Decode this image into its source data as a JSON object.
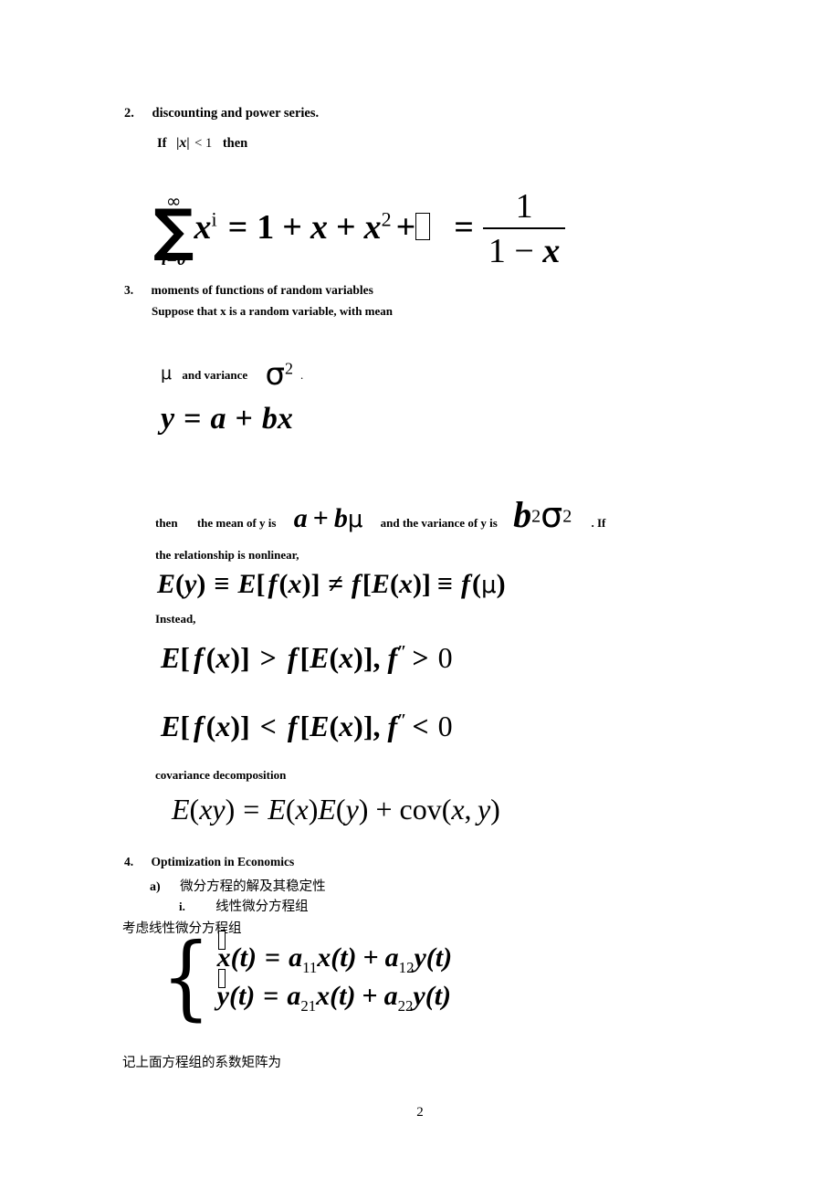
{
  "document": {
    "page_number": "2",
    "items": [
      {
        "number": "2.",
        "heading": "discounting and power series.",
        "condition_prefix": "If",
        "condition_var": "x",
        "condition_rel": "< 1",
        "condition_suffix": "then",
        "equation": {
          "sum_upper": "∞",
          "sum_lower": "i=0",
          "summand_base": "x",
          "summand_exp": "i",
          "equals": "=",
          "expansion": "1 + x + x",
          "expansion_exp": "2",
          "plus": "+",
          "missing_glyph": "□",
          "equals2": "=",
          "frac_num": "1",
          "frac_den": "1 − x"
        }
      },
      {
        "number": "3.",
        "heading": "moments of functions of random variables",
        "line1": "Suppose that x is a random variable, with mean",
        "mu": "μ",
        "and_variance": "and variance",
        "sigma": "σ",
        "sigma_exp": "2",
        "period": ".",
        "linear_eq": "y = a + bx",
        "then_label": "then",
        "mean_of_y_label": "the mean of y is",
        "mean_of_y_expr": "a + bμ",
        "variance_of_y_label": "and the variance of y is",
        "variance_of_y_expr": "b²σ²",
        "if_label": ". If",
        "nonlinear_line": "the relationship is nonlinear,",
        "jensen_eq": "E(y) ≡ E[ f (x)] ≠ f [E(x)] ≡ f (μ)",
        "instead_label": "Instead,",
        "convex_eq": "E[ f (x)] > f [E(x)], f ″ > 0",
        "concave_eq": "E[ f (x)] < f [E(x)], f ″ < 0",
        "cov_label": "covariance decomposition",
        "cov_eq": "E(xy) = E(x)E(y) + cov(x, y)"
      },
      {
        "number": "4.",
        "heading": "Optimization in Economics",
        "sub_a_marker": "a)",
        "sub_a_text": "微分方程的解及其稳定性",
        "sub_i_marker": "i.",
        "sub_i_text": "线性微分方程组",
        "intro_cjk": "考虑线性微分方程组",
        "system": {
          "row1": {
            "lhs_var": "x",
            "lhs_arg": "(t)",
            "equals": "=",
            "coef1": "a",
            "coef1_idx": "11",
            "var1": "x(t)",
            "plus": "+",
            "coef2": "a",
            "coef2_idx": "12",
            "var2": "y(t)"
          },
          "row2": {
            "lhs_var": "y",
            "lhs_arg": "(t)",
            "equals": "=",
            "coef1": "a",
            "coef1_idx": "21",
            "var1": "x(t)",
            "plus": "+",
            "coef2": "a",
            "coef2_idx": "22",
            "var2": "y(t)"
          }
        },
        "closing_cjk": "记上面方程组的系数矩阵为"
      }
    ]
  }
}
